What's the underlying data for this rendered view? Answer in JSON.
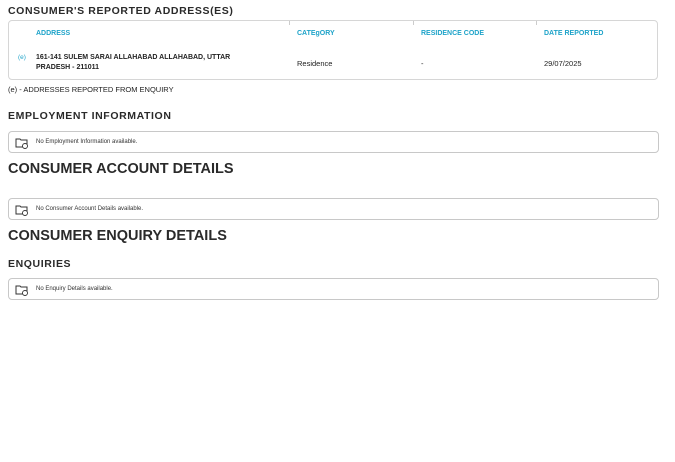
{
  "addresses": {
    "title": "CONSUMER'S REPORTED ADDRESS(ES)",
    "columns": [
      "ADDRESS",
      "CATEgORY",
      "RESIDENCE CODE",
      "DATE REPORTED"
    ],
    "rows": [
      {
        "marker": "(e)",
        "address_line1": "161-141 SULEM SARAI ALLAHABAD ALLAHABAD, UTTAR",
        "address_line2": "PRADESH - 211011",
        "category": "Residence",
        "residence_code": "-",
        "date_reported": "29/07/2025"
      }
    ],
    "note": "(e) - ADDRESSES REPORTED FROM ENQUIRY"
  },
  "employment": {
    "title": "EMPLOYMENT INFORMATION",
    "empty_text": "No Employment Information available."
  },
  "accounts": {
    "title": "CONSUMER ACCOUNT DETAILS",
    "empty_text": "No Consumer Account Details available."
  },
  "enquiry": {
    "title": "CONSUMER ENQUIRY DETAILS",
    "subtitle": "ENQUIRIES",
    "empty_text": "No Enquiry Details available."
  }
}
